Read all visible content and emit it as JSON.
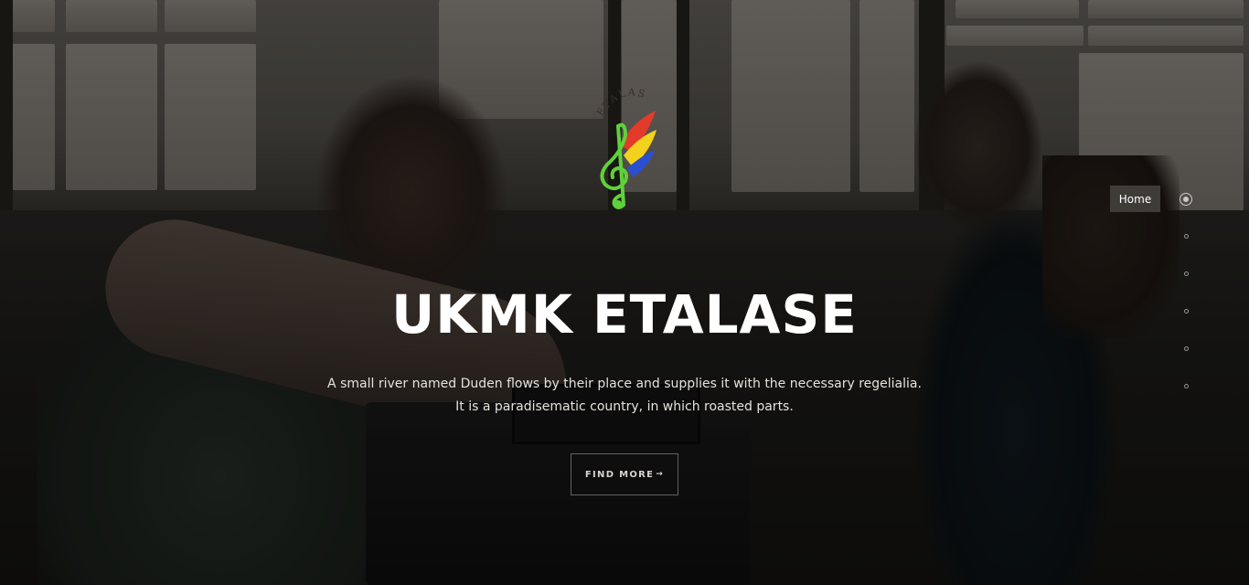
{
  "logo": {
    "name": "UKMK ETALASE logo",
    "arc_text": "ETALASE"
  },
  "hero": {
    "title": "UKMK ETALASE",
    "subtitle": "A small river named Duden flows by their place and supplies it with the necessary regelialia. It is a paradisematic country, in which roasted parts.",
    "button_label": "FIND MORE",
    "button_icon": "arrow-right-icon"
  },
  "side_nav": {
    "tooltip_label": "Home",
    "dots": [
      {
        "name": "nav-dot-home",
        "active": true
      },
      {
        "name": "nav-dot-2",
        "active": false
      },
      {
        "name": "nav-dot-3",
        "active": false
      },
      {
        "name": "nav-dot-4",
        "active": false
      },
      {
        "name": "nav-dot-5",
        "active": false
      },
      {
        "name": "nav-dot-6",
        "active": false
      }
    ]
  },
  "colors": {
    "logo_red": "#e23b2a",
    "logo_yellow": "#f3d21d",
    "logo_blue": "#2a4fd1",
    "logo_green": "#5fd13a",
    "overlay": "#000000"
  }
}
